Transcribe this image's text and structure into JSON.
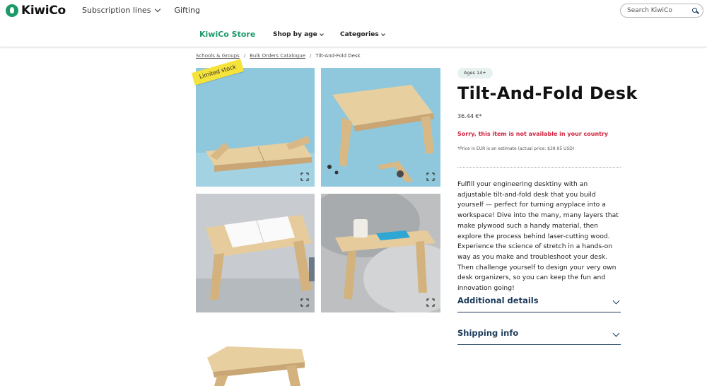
{
  "header": {
    "brand": "KiwiCo",
    "nav": [
      {
        "label": "Subscription lines",
        "has_dropdown": true
      },
      {
        "label": "Gifting",
        "has_dropdown": false
      }
    ],
    "search_placeholder": "Search KiwiCo"
  },
  "store_nav": {
    "store_label": "KiwiCo Store",
    "menus": [
      {
        "label": "Shop by age"
      },
      {
        "label": "Categories"
      }
    ]
  },
  "breadcrumb": {
    "items": [
      "Schools & Groups",
      "Bulk Orders Catalogue",
      "Tilt-And-Fold Desk"
    ],
    "separator": "/"
  },
  "gallery": {
    "badge": "Limited stock",
    "images": [
      {
        "subject": "assembled folding desk on blue background"
      },
      {
        "subject": "desk with loose parts on blue background"
      },
      {
        "subject": "desk holding open notebook"
      },
      {
        "subject": "desk on sofa with mug and book"
      },
      {
        "subject": "folded desk thumbnail"
      }
    ]
  },
  "product": {
    "age_badge": "Ages 14+",
    "title": "Tilt-And-Fold Desk",
    "price": "36.44 €*",
    "availability": "Sorry, this item is not available in your country",
    "price_note": "*Price in EUR is an estimate (actual price: $39.95 USD)",
    "description": "Fulfill your engineering desktiny with an adjustable tilt-and-fold desk that you build yourself — perfect for turning anyplace into a workspace! Dive into the many, many layers that make plywood such a handy material, then explore the process behind laser-cutting wood. Experience the science of stretch in a hands-on way as you make and troubleshoot your desk. Then challenge yourself to design your very own desk organizers, so you can keep the fun and innovation going!",
    "accordions": [
      {
        "label": "Additional details"
      },
      {
        "label": "Shipping info"
      }
    ]
  },
  "colors": {
    "brand_green": "#1c9a6a",
    "navy": "#1b3a5a",
    "alert_red": "#d0203c",
    "badge_yellow": "#f6e33a",
    "photo_blue": "#8fc7dc"
  }
}
